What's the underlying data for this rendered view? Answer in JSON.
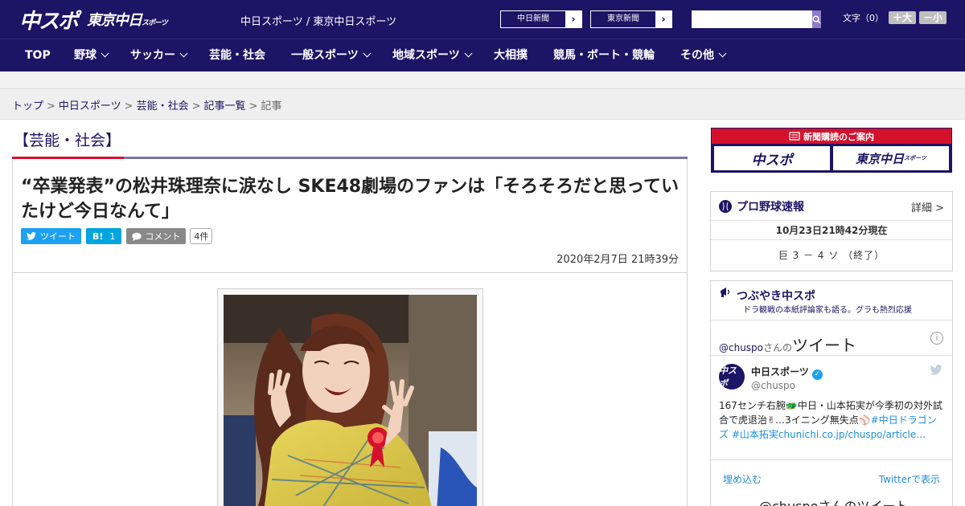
{
  "header": {
    "logo_main": "中スポ",
    "logo_sub": "東京中日",
    "logo_sub_small": "スポーツ",
    "site_names": "中日スポーツ / 東京中日スポーツ",
    "paper_buttons": [
      {
        "label": "中日新聞"
      },
      {
        "label": "東京新聞"
      }
    ],
    "search": {
      "placeholder": ""
    },
    "font_size": {
      "label": "文字（0）",
      "bigger": "＋大",
      "smaller": "－小"
    }
  },
  "nav": {
    "items": [
      {
        "label": "TOP",
        "has_menu": false
      },
      {
        "label": "野球",
        "has_menu": true
      },
      {
        "label": "サッカー",
        "has_menu": true
      },
      {
        "label": "芸能・社会",
        "has_menu": false
      },
      {
        "label": "一般スポーツ",
        "has_menu": true
      },
      {
        "label": "地域スポーツ",
        "has_menu": true
      },
      {
        "label": "大相撲",
        "has_menu": false
      },
      {
        "label": "競馬・ボート・競輪",
        "has_menu": false
      },
      {
        "label": "その他",
        "has_menu": true
      }
    ]
  },
  "breadcrumb": {
    "items": [
      "トップ",
      "中日スポーツ",
      "芸能・社会",
      "記事一覧"
    ],
    "current": "記事",
    "separator": ">"
  },
  "article": {
    "category": "【芸能・社会】",
    "headline": "“卒業発表”の松井珠理奈に涙なし SKE48劇場のファンは「そろそろだと思っていたけど今日なんて」",
    "share": {
      "tweet_label": "ツイート",
      "hatena_label": "B!",
      "hatena_count": "1",
      "comment_label": "コメント",
      "comment_count": "4件"
    },
    "date": "2020年2月7日 21時39分"
  },
  "sidebar": {
    "subscription": {
      "title": "新聞購読のご案内",
      "left": "中スポ",
      "right": "東京中日",
      "right_small": "スポーツ"
    },
    "baseball": {
      "title": "プロ野球速報",
      "detail": "詳細 >",
      "timestamp": "10月23日21時42分現在",
      "score": "巨 3 － 4 ソ （終了）"
    },
    "tweets": {
      "title": "つぶやき中スポ",
      "subtitle": "ドラ観戦の本紙評論家も語る。グラも熱烈応援",
      "timeline_handle": "@chuspo",
      "timeline_san": "さんの",
      "timeline_label": "ツイート",
      "account_name": "中日スポーツ",
      "account_user": "@chuspo",
      "avatar_text": "中スポ",
      "tweet_text_plain": "167センチ右腕🐲中日・山本拓実が今季初の対外試合で虎退治✌…3イニング無失点⚾",
      "tweet_hashtags": "#中日ドラゴンズ #山本拓実chunichi.co.jp/chuspo/article…",
      "embed_label": "埋め込む",
      "view_label": "Twitterで表示",
      "next_label": "@chuspoさんのツイート"
    }
  },
  "colors": {
    "brand_navy": "#1c1464",
    "accent_red": "#d4112d",
    "rule_purple": "#7a74a8",
    "twitter_blue": "#1da1f2"
  }
}
